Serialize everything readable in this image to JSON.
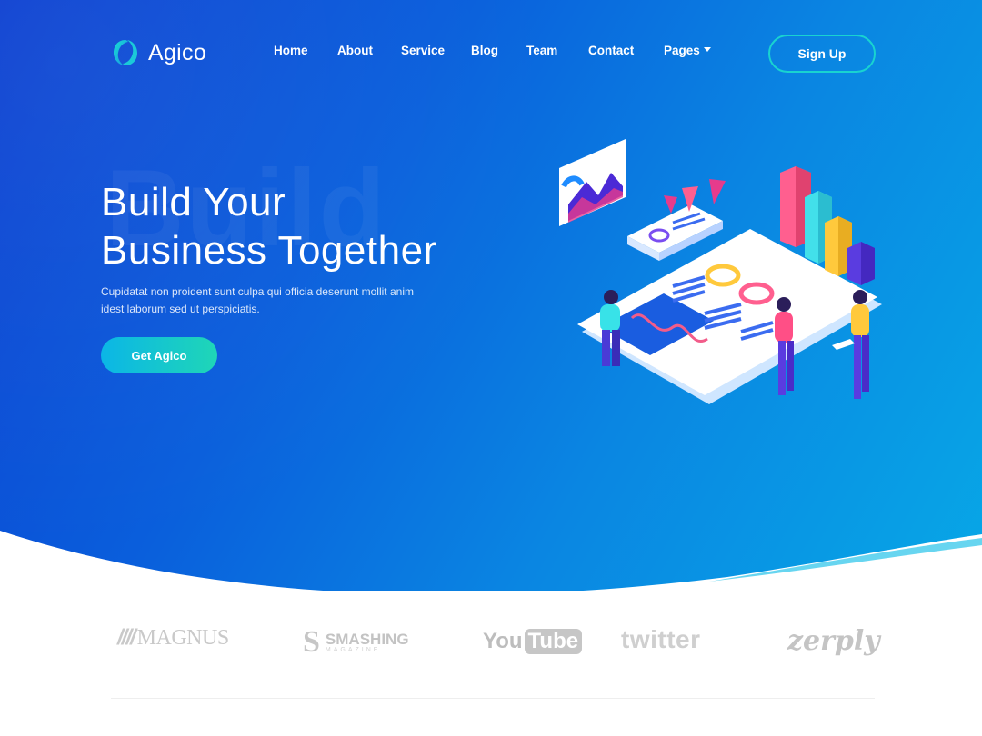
{
  "header": {
    "logo_text": "Agico",
    "nav": [
      {
        "label": "Home"
      },
      {
        "label": "About"
      },
      {
        "label": "Service"
      },
      {
        "label": "Blog"
      },
      {
        "label": "Team"
      },
      {
        "label": "Contact"
      },
      {
        "label": "Pages"
      }
    ],
    "signup_label": "Sign Up"
  },
  "hero": {
    "ghost_word": "Build",
    "headline_line1": "Build Your",
    "headline_line2": "Business Together",
    "subtext": "Cupidatat non proident sunt culpa qui officia deserunt mollit anim idest laborum sed ut perspiciatis.",
    "cta_label": "Get Agico"
  },
  "brands": {
    "magnus": "MAGNUS",
    "magnus_mark": "////",
    "smashing": "SMASHING",
    "smashing_sub": "MAGAZINE",
    "youtube_you": "You",
    "youtube_tube": "Tube",
    "twitter": "twitter",
    "zerply": "zerply"
  },
  "colors": {
    "hero_start": "#0b3fd1",
    "hero_end": "#07a7e6",
    "accent_teal": "#19d3d0",
    "cta_gradient_start": "#0bb6e6",
    "cta_gradient_end": "#1fd6b7"
  }
}
